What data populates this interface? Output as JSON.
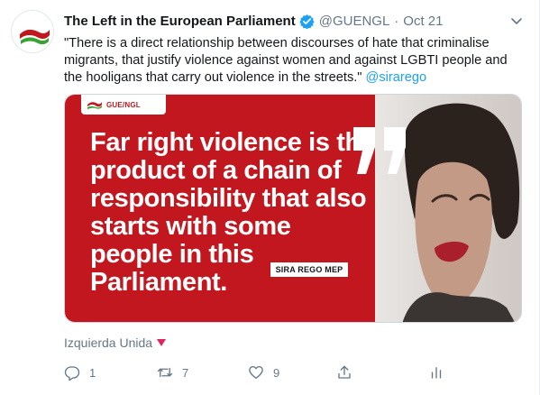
{
  "author": {
    "display_name": "The Left in the European Parliament",
    "handle": "@GUENGL",
    "separator": "·",
    "time": "Oct 21"
  },
  "tweet": {
    "text_before": "\"There is a direct relationship between discourses of hate that criminalise migrants, that justify violence against women and against LGBTI people and the hooligans that carry out violence in the streets.\" ",
    "mention": "@sirarego"
  },
  "media": {
    "logo_text": "GUE/NGL",
    "headline": "Far right violence is the product of a chain of responsibility that also starts with some people in this Parliament.",
    "speaker": "SIRA REGO MEP",
    "accent_color": "#c2171e"
  },
  "source": {
    "label": "Izquierda Unida"
  },
  "actions": {
    "reply_count": "1",
    "retweet_count": "7",
    "like_count": "9"
  },
  "colors": {
    "link": "#1da1f2",
    "muted": "#657786",
    "flag": "#e0245e"
  }
}
